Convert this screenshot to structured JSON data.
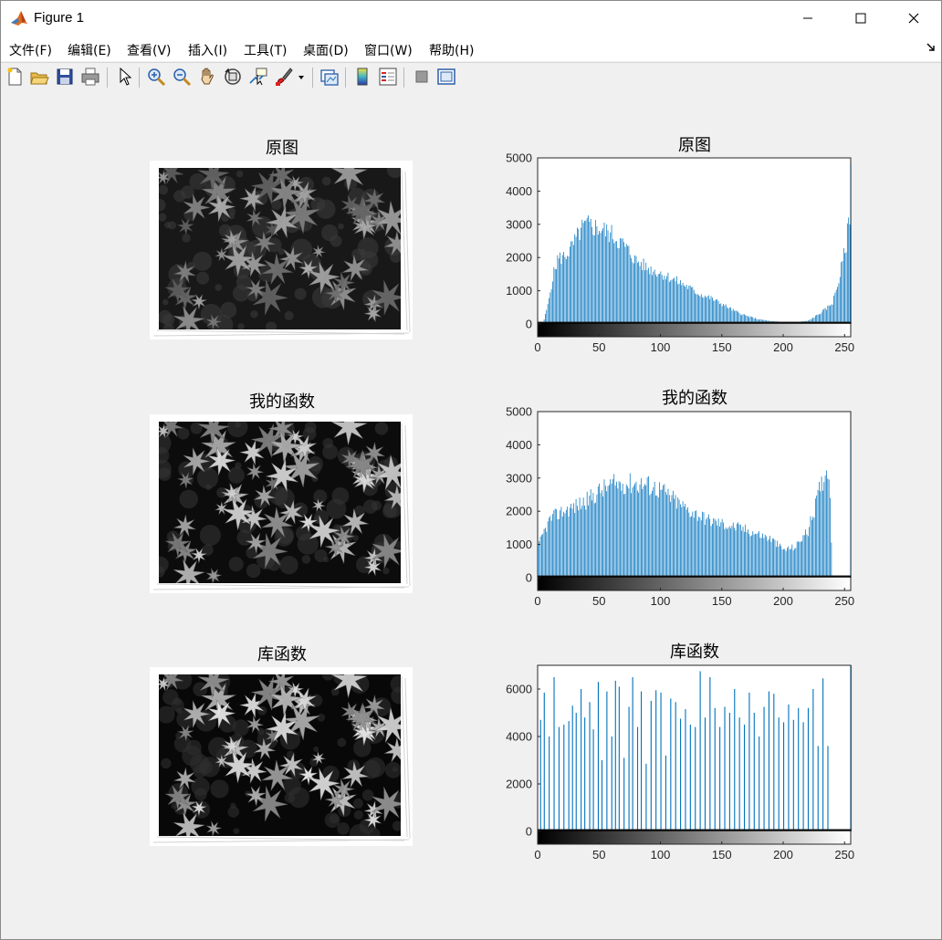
{
  "window": {
    "title": "Figure 1",
    "controls": {
      "minimize": "—",
      "maximize": "☐",
      "close": "✕"
    }
  },
  "menu": [
    "文件(F)",
    "编辑(E)",
    "查看(V)",
    "插入(I)",
    "工具(T)",
    "桌面(D)",
    "窗口(W)",
    "帮助(H)"
  ],
  "toolbar": [
    "new-figure-icon",
    "open-file-icon",
    "save-icon",
    "print-icon",
    "edit-plot-arrow-icon",
    "zoom-in-icon",
    "zoom-out-icon",
    "pan-hand-icon",
    "rotate-3d-icon",
    "data-cursor-icon",
    "brush-icon",
    "brush-dropdown-icon",
    "link-plot-icon",
    "colorbar-icon",
    "legend-icon",
    "hide-plot-tools-icon",
    "show-plot-tools-icon"
  ],
  "panels": [
    {
      "image_title": "原图",
      "contrast": "original"
    },
    {
      "image_title": "我的函数",
      "contrast": "stretched"
    },
    {
      "image_title": "库函数",
      "contrast": "equalized"
    }
  ],
  "chart_data": [
    {
      "type": "bar",
      "title": "原图",
      "xlim": [
        0,
        255
      ],
      "ylim": [
        0,
        5000
      ],
      "xticks": [
        0,
        50,
        100,
        150,
        200,
        250
      ],
      "yticks": [
        0,
        1000,
        2000,
        3000,
        4000,
        5000
      ],
      "colorbar": "grayscale",
      "envelope": [
        [
          0,
          0
        ],
        [
          4,
          0
        ],
        [
          8,
          600
        ],
        [
          12,
          1500
        ],
        [
          16,
          2100
        ],
        [
          22,
          2200
        ],
        [
          28,
          2500
        ],
        [
          35,
          3050
        ],
        [
          40,
          3200
        ],
        [
          50,
          3100
        ],
        [
          60,
          2900
        ],
        [
          70,
          2550
        ],
        [
          80,
          2050
        ],
        [
          90,
          1800
        ],
        [
          100,
          1650
        ],
        [
          110,
          1450
        ],
        [
          120,
          1250
        ],
        [
          130,
          1000
        ],
        [
          140,
          850
        ],
        [
          150,
          650
        ],
        [
          160,
          420
        ],
        [
          170,
          260
        ],
        [
          180,
          150
        ],
        [
          190,
          90
        ],
        [
          200,
          60
        ],
        [
          210,
          60
        ],
        [
          220,
          100
        ],
        [
          228,
          300
        ],
        [
          235,
          500
        ],
        [
          240,
          700
        ],
        [
          245,
          1400
        ],
        [
          248,
          2000
        ],
        [
          251,
          2600
        ],
        [
          254,
          3600
        ],
        [
          255,
          5000
        ]
      ]
    },
    {
      "type": "bar",
      "title": "我的函数",
      "xlim": [
        0,
        255
      ],
      "ylim": [
        0,
        5000
      ],
      "xticks": [
        0,
        50,
        100,
        150,
        200,
        250
      ],
      "yticks": [
        0,
        1000,
        2000,
        3000,
        4000,
        5000
      ],
      "colorbar": "grayscale",
      "envelope": [
        [
          0,
          1000
        ],
        [
          5,
          1500
        ],
        [
          10,
          1900
        ],
        [
          20,
          2150
        ],
        [
          30,
          2300
        ],
        [
          40,
          2500
        ],
        [
          50,
          2800
        ],
        [
          60,
          3000
        ],
        [
          70,
          3050
        ],
        [
          80,
          3050
        ],
        [
          90,
          3000
        ],
        [
          100,
          2850
        ],
        [
          110,
          2550
        ],
        [
          120,
          2250
        ],
        [
          130,
          2050
        ],
        [
          140,
          1850
        ],
        [
          150,
          1750
        ],
        [
          160,
          1650
        ],
        [
          170,
          1550
        ],
        [
          180,
          1400
        ],
        [
          190,
          1250
        ],
        [
          200,
          900
        ],
        [
          210,
          1000
        ],
        [
          215,
          1300
        ],
        [
          220,
          1500
        ],
        [
          225,
          2200
        ],
        [
          230,
          2950
        ],
        [
          234,
          3400
        ],
        [
          237,
          3600
        ],
        [
          240,
          0
        ],
        [
          254,
          0
        ],
        [
          255,
          5000
        ]
      ]
    },
    {
      "type": "bar",
      "title": "库函数",
      "xlim": [
        0,
        255
      ],
      "ylim": [
        0,
        7000
      ],
      "xticks": [
        0,
        50,
        100,
        150,
        200,
        250
      ],
      "yticks": [
        0,
        2000,
        4000,
        6000
      ],
      "colorbar": "grayscale",
      "x": [
        2,
        5,
        9,
        13,
        17,
        21,
        25,
        28,
        31,
        35,
        38,
        42,
        45,
        49,
        52,
        56,
        60,
        63,
        66,
        70,
        74,
        77,
        81,
        84,
        88,
        92,
        96,
        100,
        104,
        108,
        112,
        116,
        120,
        124,
        128,
        132,
        136,
        140,
        144,
        148,
        152,
        156,
        160,
        164,
        168,
        172,
        176,
        180,
        184,
        188,
        192,
        196,
        200,
        204,
        208,
        212,
        216,
        220,
        224,
        228,
        232,
        236,
        240,
        255
      ],
      "values": [
        4700,
        5850,
        4000,
        6500,
        4400,
        4500,
        4650,
        5300,
        5000,
        6000,
        4800,
        5450,
        4300,
        6300,
        3000,
        5900,
        4000,
        6350,
        6100,
        3100,
        5250,
        6500,
        4400,
        5900,
        2850,
        5500,
        5950,
        5850,
        3200,
        5600,
        5450,
        4750,
        5150,
        4500,
        4400,
        6750,
        4800,
        6500,
        5200,
        4400,
        5250,
        5000,
        6000,
        4800,
        4500,
        5850,
        5000,
        4000,
        5250,
        5900,
        5800,
        4800,
        4600,
        5350,
        4700,
        5200,
        4600,
        5200,
        6000,
        3600,
        6450,
        3600,
        0,
        7000
      ]
    }
  ]
}
